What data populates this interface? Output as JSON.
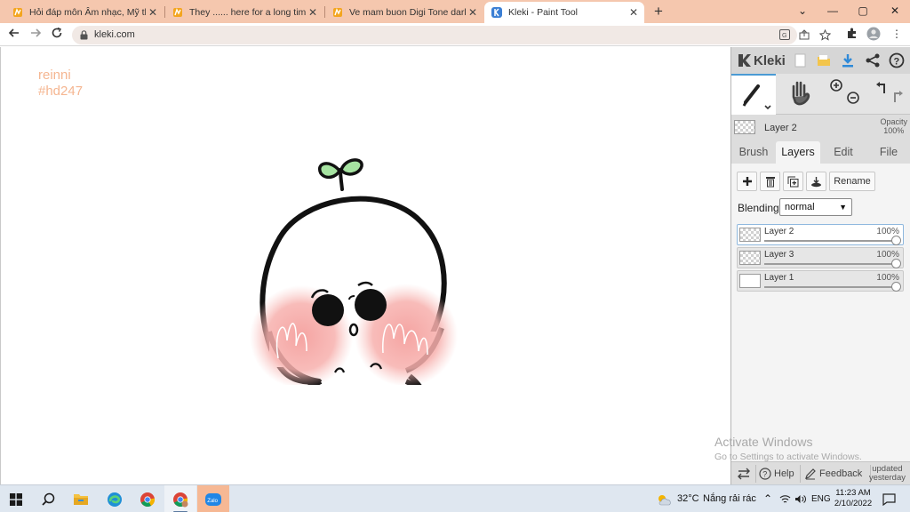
{
  "browser": {
    "tabs": [
      {
        "title": "Hỏi đáp môn Âm nhạc, Mỹ thuật",
        "active": false
      },
      {
        "title": "They ...... here for a long time. \" M",
        "active": false
      },
      {
        "title": "Ve mam buon Digi Tone dark Cs",
        "active": false
      },
      {
        "title": "Kleki - Paint Tool",
        "active": true
      }
    ],
    "url": "kleki.com",
    "window_controls": {
      "minimize": "⌄",
      "restore": "—",
      "maximize": "▢",
      "close": "✕"
    }
  },
  "canvas": {
    "signature_line1": "reinni",
    "signature_line2": "#hd247"
  },
  "kleki": {
    "logo": "Kleki",
    "current_layer": {
      "name": "Layer 2",
      "opacity_label": "Opacity",
      "opacity_value": "100%"
    },
    "tabs": [
      "Brush",
      "Layers",
      "Edit",
      "File"
    ],
    "active_tab": "Layers",
    "rename_label": "Rename",
    "blending_label": "Blending",
    "blending_value": "normal",
    "layers": [
      {
        "name": "Layer 2",
        "opacity": "100%",
        "selected": true
      },
      {
        "name": "Layer 3",
        "opacity": "100%",
        "selected": false
      },
      {
        "name": "Layer 1",
        "opacity": "100%",
        "selected": false
      }
    ],
    "help_label": "Help",
    "feedback_label": "Feedback",
    "updated_line1": "updated",
    "updated_line2": "yesterday"
  },
  "watermark": {
    "line1": "Activate Windows",
    "line2": "Go to Settings to activate Windows."
  },
  "taskbar": {
    "weather_temp": "32°C",
    "weather_text": "Nắng rải rác",
    "language": "ENG",
    "time": "11:23 AM",
    "date": "2/10/2022",
    "zalo_label": "Zalo"
  },
  "colors": {
    "tab_strip": "#f5c7ae",
    "accent": "#4a9ad4",
    "blush": "#f7a9a6",
    "sprout": "#a6e3a1",
    "signature": "#f5b691"
  }
}
